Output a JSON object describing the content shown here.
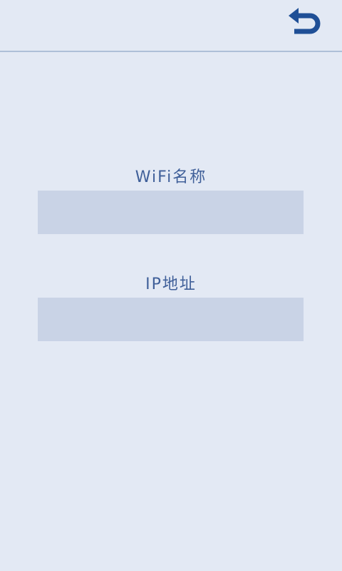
{
  "header": {
    "back_icon": "undo-arrow-icon",
    "accent_color": "#1f4f96"
  },
  "form": {
    "wifi_label": "WiFi名称",
    "wifi_value": "",
    "ip_label": "IP地址",
    "ip_value": ""
  }
}
